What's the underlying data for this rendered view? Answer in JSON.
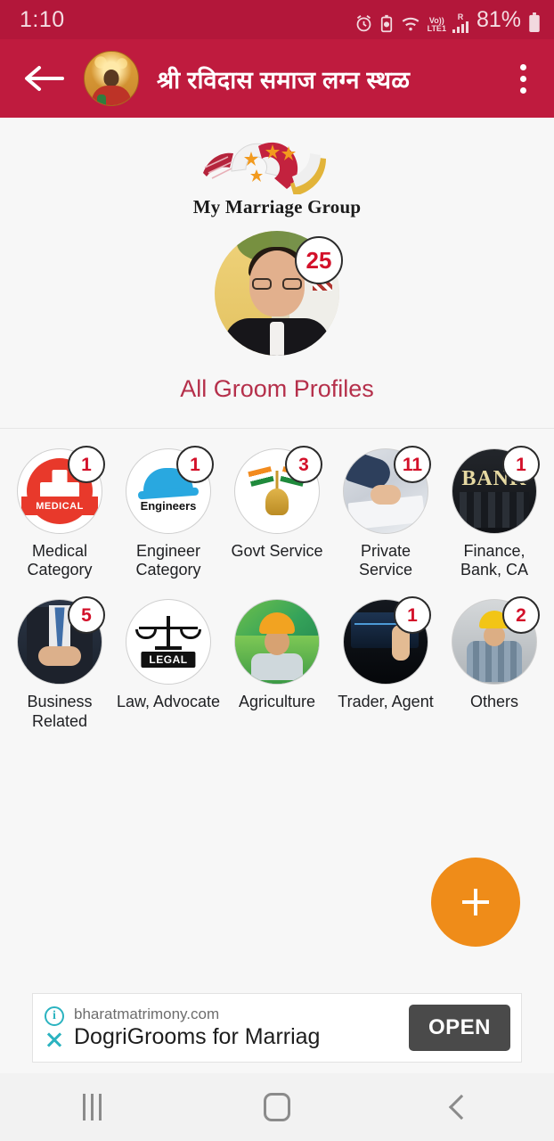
{
  "status_bar": {
    "time": "1:10",
    "battery_percent": "81%",
    "network_label": "Vo))",
    "network_sub": "LTE1",
    "roaming": "R",
    "icons": [
      "alarm-icon",
      "battery-saver-icon",
      "wifi-icon",
      "volte-icon",
      "signal-icon",
      "battery-icon"
    ]
  },
  "app_bar": {
    "title": "श्री रविदास समाज लग्न स्थळ",
    "back_icon": "back-arrow-icon",
    "avatar_icon": "guru-avatar-icon",
    "overflow_icon": "overflow-menu-icon"
  },
  "brand": {
    "name": "My Marriage Group",
    "logo_icon": "marriage-group-logo-icon"
  },
  "hero": {
    "label": "All Groom Profiles",
    "badge": "25",
    "photo_icon": "groom-photo-icon"
  },
  "categories": [
    {
      "label": "Medical Category",
      "badge": "1",
      "icon": "medical-icon",
      "icon_text": "MEDICAL"
    },
    {
      "label": "Engineer Category",
      "badge": "1",
      "icon": "engineer-icon",
      "icon_text": "Engineers"
    },
    {
      "label": "Govt Service",
      "badge": "3",
      "icon": "govt-service-icon",
      "icon_text": ""
    },
    {
      "label": "Private Service",
      "badge": "11",
      "icon": "private-service-icon",
      "icon_text": ""
    },
    {
      "label": "Finance, Bank, CA",
      "badge": "1",
      "icon": "bank-icon",
      "icon_text": "BANK"
    },
    {
      "label": "Business Related",
      "badge": "5",
      "icon": "business-icon",
      "icon_text": ""
    },
    {
      "label": "Law, Advocate",
      "badge": "",
      "icon": "law-icon",
      "icon_text": "LEGAL"
    },
    {
      "label": "Agriculture",
      "badge": "",
      "icon": "agriculture-icon",
      "icon_text": ""
    },
    {
      "label": "Trader, Agent",
      "badge": "1",
      "icon": "trader-icon",
      "icon_text": ""
    },
    {
      "label": "Others",
      "badge": "2",
      "icon": "others-icon",
      "icon_text": ""
    }
  ],
  "fab": {
    "icon": "plus-icon"
  },
  "ad": {
    "url": "bharatmatrimony.com",
    "headline": "DogriGrooms for Marriag",
    "cta": "OPEN",
    "info_glyph": "i",
    "info_icon": "ad-info-icon",
    "close_icon": "ad-close-icon"
  },
  "nav_bar": {
    "recents_icon": "recents-icon",
    "home_icon": "home-icon",
    "back_icon": "nav-back-icon"
  },
  "colors": {
    "header": "#bf1b3e",
    "status": "#b3173a",
    "accent_label": "#b5304b",
    "badge_text": "#d3112a",
    "fab": "#ef8c19",
    "ad_cta": "#4a4a4a",
    "ad_icon": "#2bb3c0"
  }
}
